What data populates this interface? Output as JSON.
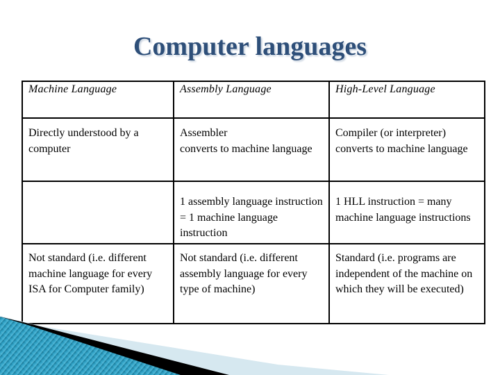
{
  "slide": {
    "title": "Computer languages"
  },
  "table": {
    "headers": [
      "Machine Language",
      "Assembly Language",
      "High-Level Language"
    ],
    "rows": [
      {
        "machine": "Directly understood by a computer",
        "assembly": "Assembler converts to machine language",
        "high_level": "Compiler (or interpreter) converts to machine language"
      },
      {
        "machine": "",
        "assembly": "1 assembly language instruction = 1 machine language instruction",
        "high_level": "1 HLL instruction = many machine language instructions"
      },
      {
        "machine": "Not standard (i.e. different machine language for every ISA for Computer family)",
        "assembly": "Not standard (i.e. different assembly language for every type of machine)",
        "high_level": "Standard (i.e. programs are independent of the machine on which they will be executed)"
      }
    ]
  },
  "colors": {
    "title": "#2E4F79",
    "decoration_teal": "#1F7FA0",
    "decoration_light": "#D6E8F0"
  }
}
